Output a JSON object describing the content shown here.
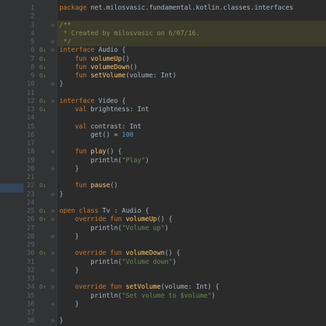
{
  "editor": {
    "lines": [
      {
        "n": "1",
        "marker": "",
        "fold": "",
        "code": [
          {
            "t": "package ",
            "c": "kw"
          },
          {
            "t": "net.milosvasic.fundamental.kotlin.classes.interfaces",
            "c": ""
          }
        ]
      },
      {
        "n": "2",
        "marker": "",
        "fold": "",
        "code": []
      },
      {
        "n": "3",
        "marker": "",
        "fold": "⊖",
        "code": [
          {
            "t": "/**",
            "c": "cmt"
          }
        ]
      },
      {
        "n": "4",
        "marker": "",
        "fold": "",
        "code": [
          {
            "t": " * Created by milosvasic on 6/07/16.",
            "c": "cmt"
          }
        ]
      },
      {
        "n": "5",
        "marker": "",
        "fold": "⊖",
        "code": [
          {
            "t": " */",
            "c": "cmt"
          }
        ]
      },
      {
        "n": "6",
        "marker": "O↓",
        "fold": "⊖",
        "code": [
          {
            "t": "interface ",
            "c": "kw"
          },
          {
            "t": "Audio {",
            "c": ""
          }
        ]
      },
      {
        "n": "7",
        "marker": "O↓",
        "fold": "",
        "code": [
          {
            "t": "    fun ",
            "c": "kw"
          },
          {
            "t": "volumeUp",
            "c": "fn"
          },
          {
            "t": "()",
            "c": ""
          }
        ]
      },
      {
        "n": "8",
        "marker": "O↓",
        "fold": "",
        "code": [
          {
            "t": "    fun ",
            "c": "kw"
          },
          {
            "t": "volumeDown",
            "c": "fn"
          },
          {
            "t": "()",
            "c": ""
          }
        ]
      },
      {
        "n": "9",
        "marker": "O↓",
        "fold": "",
        "code": [
          {
            "t": "    fun ",
            "c": "kw"
          },
          {
            "t": "setVolume",
            "c": "fn"
          },
          {
            "t": "(volume: Int)",
            "c": ""
          }
        ]
      },
      {
        "n": "10",
        "marker": "",
        "fold": "⊖",
        "code": [
          {
            "t": "}",
            "c": ""
          }
        ]
      },
      {
        "n": "11",
        "marker": "",
        "fold": "",
        "code": []
      },
      {
        "n": "12",
        "marker": "O↓",
        "fold": "⊖",
        "code": [
          {
            "t": "interface ",
            "c": "kw"
          },
          {
            "t": "Video {",
            "c": ""
          }
        ]
      },
      {
        "n": "13",
        "marker": "O↓",
        "fold": "",
        "code": [
          {
            "t": "    val ",
            "c": "kw"
          },
          {
            "t": "brightness: Int",
            "c": ""
          }
        ]
      },
      {
        "n": "14",
        "marker": "",
        "fold": "",
        "code": []
      },
      {
        "n": "15",
        "marker": "",
        "fold": "",
        "code": [
          {
            "t": "    val ",
            "c": "kw"
          },
          {
            "t": "contrast: Int",
            "c": ""
          }
        ]
      },
      {
        "n": "16",
        "marker": "",
        "fold": "",
        "code": [
          {
            "t": "        get",
            "c": ""
          },
          {
            "t": "() = ",
            "c": ""
          },
          {
            "t": "100",
            "c": "num"
          }
        ]
      },
      {
        "n": "17",
        "marker": "",
        "fold": "",
        "code": []
      },
      {
        "n": "18",
        "marker": "",
        "fold": "⊖",
        "code": [
          {
            "t": "    fun ",
            "c": "kw"
          },
          {
            "t": "play",
            "c": "fn"
          },
          {
            "t": "() {",
            "c": ""
          }
        ]
      },
      {
        "n": "19",
        "marker": "",
        "fold": "",
        "code": [
          {
            "t": "        println",
            "c": ""
          },
          {
            "t": "(",
            "c": ""
          },
          {
            "t": "\"Play\"",
            "c": "str"
          },
          {
            "t": ")",
            "c": ""
          }
        ]
      },
      {
        "n": "20",
        "marker": "",
        "fold": "⊖",
        "code": [
          {
            "t": "    }",
            "c": ""
          }
        ]
      },
      {
        "n": "21",
        "marker": "",
        "fold": "",
        "code": []
      },
      {
        "n": "22",
        "marker": "O↓",
        "fold": "",
        "code": [
          {
            "t": "    fun ",
            "c": "kw"
          },
          {
            "t": "pause",
            "c": "fn"
          },
          {
            "t": "()",
            "c": ""
          }
        ]
      },
      {
        "n": "23",
        "marker": "",
        "fold": "⊖",
        "code": [
          {
            "t": "}",
            "c": ""
          }
        ]
      },
      {
        "n": "24",
        "marker": "",
        "fold": "",
        "code": []
      },
      {
        "n": "25",
        "marker": "O↓",
        "fold": "⊖",
        "code": [
          {
            "t": "open class ",
            "c": "kw"
          },
          {
            "t": "Tv : Audio {",
            "c": ""
          }
        ]
      },
      {
        "n": "26",
        "marker": "O↑",
        "fold": "⊖",
        "code": [
          {
            "t": "    override fun ",
            "c": "kw"
          },
          {
            "t": "volumeUp",
            "c": "fn"
          },
          {
            "t": "() {",
            "c": ""
          }
        ]
      },
      {
        "n": "27",
        "marker": "",
        "fold": "",
        "code": [
          {
            "t": "        println",
            "c": ""
          },
          {
            "t": "(",
            "c": ""
          },
          {
            "t": "\"Volume up\"",
            "c": "str"
          },
          {
            "t": ")",
            "c": ""
          }
        ]
      },
      {
        "n": "28",
        "marker": "",
        "fold": "⊖",
        "code": [
          {
            "t": "    }",
            "c": ""
          }
        ]
      },
      {
        "n": "29",
        "marker": "",
        "fold": "",
        "code": []
      },
      {
        "n": "30",
        "marker": "O↑",
        "fold": "⊖",
        "code": [
          {
            "t": "    override fun ",
            "c": "kw"
          },
          {
            "t": "volumeDown",
            "c": "fn"
          },
          {
            "t": "() {",
            "c": ""
          }
        ]
      },
      {
        "n": "31",
        "marker": "",
        "fold": "",
        "code": [
          {
            "t": "        println",
            "c": ""
          },
          {
            "t": "(",
            "c": ""
          },
          {
            "t": "\"Volume down\"",
            "c": "str"
          },
          {
            "t": ")",
            "c": ""
          }
        ]
      },
      {
        "n": "32",
        "marker": "",
        "fold": "⊖",
        "code": [
          {
            "t": "    }",
            "c": ""
          }
        ]
      },
      {
        "n": "33",
        "marker": "",
        "fold": "",
        "code": []
      },
      {
        "n": "34",
        "marker": "O↑",
        "fold": "⊖",
        "code": [
          {
            "t": "    override fun ",
            "c": "kw"
          },
          {
            "t": "setVolume",
            "c": "fn"
          },
          {
            "t": "(volume: Int) {",
            "c": ""
          }
        ]
      },
      {
        "n": "35",
        "marker": "",
        "fold": "",
        "code": [
          {
            "t": "        println",
            "c": ""
          },
          {
            "t": "(",
            "c": ""
          },
          {
            "t": "\"Set volume to $volume\"",
            "c": "str"
          },
          {
            "t": ")",
            "c": ""
          }
        ]
      },
      {
        "n": "36",
        "marker": "",
        "fold": "⊖",
        "code": [
          {
            "t": "    }",
            "c": ""
          }
        ]
      },
      {
        "n": "37",
        "marker": "",
        "fold": "",
        "code": []
      },
      {
        "n": "38",
        "marker": "",
        "fold": "⊖",
        "code": [
          {
            "t": "}",
            "c": ""
          }
        ]
      }
    ]
  }
}
